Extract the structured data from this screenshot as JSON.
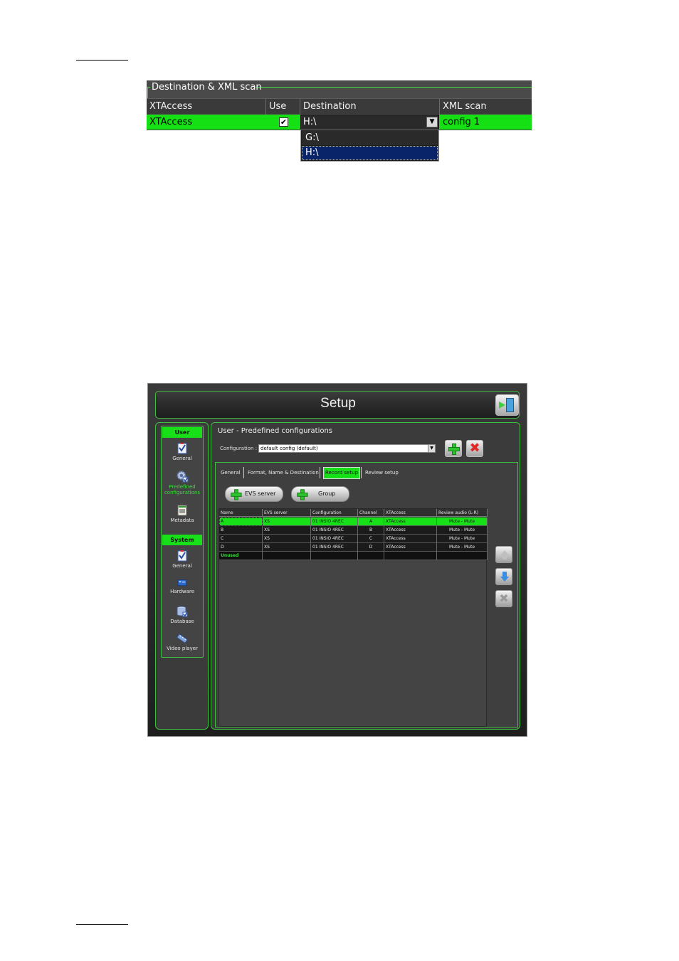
{
  "shot1": {
    "group_title": "Destination & XML scan",
    "columns": [
      "XTAccess",
      "Use",
      "Destination",
      "XML scan"
    ],
    "row": {
      "xtaccess": "XTAccess",
      "use_checked": "✔",
      "destination": "H:\\",
      "xml_scan": "config 1"
    },
    "dropdown_options": [
      "G:\\",
      "H:\\"
    ],
    "selected_option": "H:\\",
    "colors": {
      "row_highlight": "#14e014",
      "selection": "#0a246a"
    }
  },
  "setup": {
    "title": "Setup",
    "sidebar": {
      "user_header": "User",
      "user_items": [
        {
          "label": "General",
          "icon": "checklist-icon"
        },
        {
          "label": "Predefined configurations",
          "icon": "gear-config-icon",
          "active": true
        },
        {
          "label": "Metadata",
          "icon": "document-icon"
        }
      ],
      "system_header": "System",
      "system_items": [
        {
          "label": "General",
          "icon": "checklist-icon"
        },
        {
          "label": "Hardware",
          "icon": "hardware-card-icon"
        },
        {
          "label": "Database",
          "icon": "database-icon"
        },
        {
          "label": "Video player",
          "icon": "film-icon"
        }
      ]
    },
    "main": {
      "section_title": "User - Predefined configurations",
      "configuration_label": "Configuration :",
      "configuration_value": "default config (default)",
      "tabs": [
        "General",
        "Format, Name & Destination",
        "Record setup",
        "Review setup"
      ],
      "active_tab": "Record setup",
      "buttons": {
        "evs_server": "EVS server",
        "group": "Group"
      },
      "grid": {
        "columns": [
          "Name",
          "EVS server",
          "Configuration",
          "Channel",
          "XTAccess",
          "Review audio (L-R)"
        ],
        "rows": [
          [
            "A",
            "XS",
            "01 INSIO 4REC",
            "A",
            "XTAccess",
            "Mute - Mute"
          ],
          [
            "B",
            "XS",
            "01 INSIO 4REC",
            "B",
            "XTAccess",
            "Mute - Mute"
          ],
          [
            "C",
            "XS",
            "01 INSIO 4REC",
            "C",
            "XTAccess",
            "Mute - Mute"
          ],
          [
            "D",
            "XS",
            "01 INSIO 4REC",
            "D",
            "XTAccess",
            "Mute - Mute"
          ]
        ],
        "unused_label": "Unused",
        "selected_row": 0
      }
    },
    "colors": {
      "accent": "#18e018",
      "frame_green": "#3fbf3f",
      "background": "#3b3b3b"
    }
  }
}
